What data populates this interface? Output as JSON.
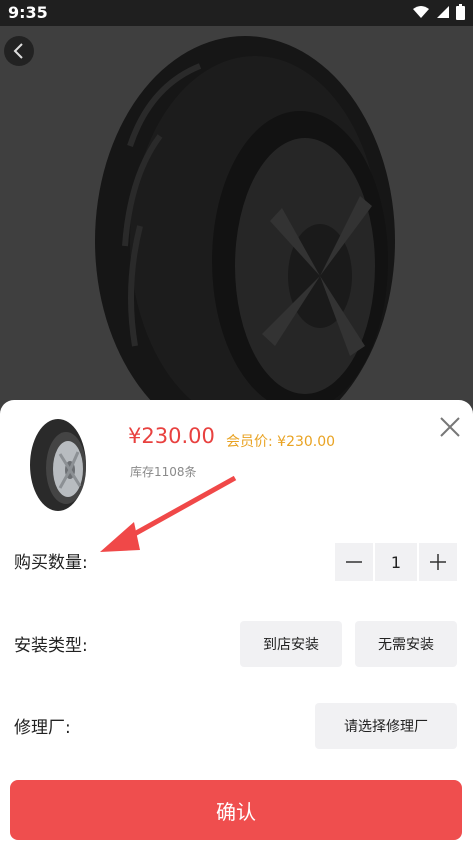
{
  "status_bar": {
    "time": "9:35"
  },
  "product": {
    "price": "¥230.00",
    "member_price": "会员价: ¥230.00",
    "stock": "库存1108条"
  },
  "options": {
    "quantity_label": "购买数量:",
    "quantity_value": "1",
    "install_label": "安装类型:",
    "install_choices": [
      "到店安装",
      "无需安装"
    ],
    "repair_label": "修理厂:",
    "repair_select": "请选择修理厂"
  },
  "confirm_label": "确认",
  "colors": {
    "accent": "#ef4e4e",
    "price": "#e8413f",
    "member": "#e9a323"
  }
}
